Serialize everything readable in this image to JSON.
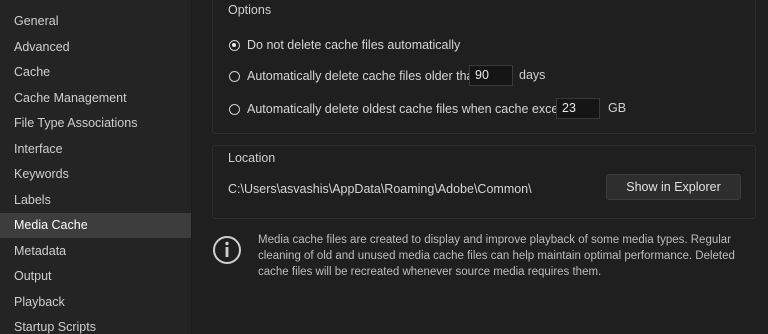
{
  "sidebar": {
    "items": [
      {
        "label": "General"
      },
      {
        "label": "Advanced"
      },
      {
        "label": "Cache"
      },
      {
        "label": "Cache Management"
      },
      {
        "label": "File Type Associations"
      },
      {
        "label": "Interface"
      },
      {
        "label": "Keywords"
      },
      {
        "label": "Labels"
      },
      {
        "label": "Media Cache",
        "selected": true
      },
      {
        "label": "Metadata"
      },
      {
        "label": "Output"
      },
      {
        "label": "Playback"
      },
      {
        "label": "Startup Scripts"
      }
    ]
  },
  "options": {
    "title": "Options",
    "radio1": {
      "label": "Do not delete cache files automatically",
      "checked": true
    },
    "radio2": {
      "label": "Automatically delete cache files older than",
      "value": "90",
      "unit": "days",
      "checked": false
    },
    "radio3": {
      "label": "Automatically delete oldest cache files when cache exceeds",
      "value": "23",
      "unit": "GB",
      "checked": false
    }
  },
  "location": {
    "title": "Location",
    "path": "C:\\Users\\asvashis\\AppData\\Roaming\\Adobe\\Common\\",
    "button_label": "Show in Explorer"
  },
  "info": {
    "icon": "info-icon",
    "text": "Media cache files are created to display and improve playback of some media types. Regular cleaning of old and unused media cache files can help maintain optimal performance. Deleted cache files will be recreated whenever source media requires them."
  },
  "colors": {
    "background": "#1f1f1f",
    "sidebar_bg": "#242424",
    "selected_bg": "#3d3d3d"
  }
}
